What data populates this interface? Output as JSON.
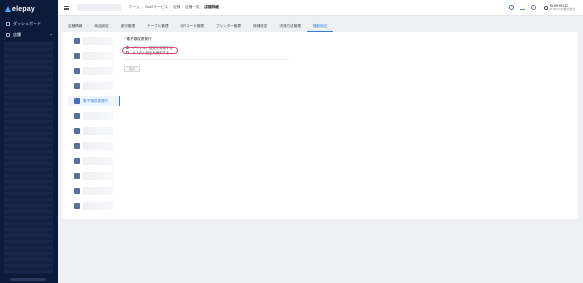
{
  "sidebar": {
    "logo_text": "elepay",
    "items": [
      {
        "label": "ダッシュボード"
      },
      {
        "label": "店舗"
      }
    ]
  },
  "header": {
    "breadcrumb": [
      "ホーム",
      "SaaSサービス",
      "店舗",
      "店舗一覧",
      "店舗詳細"
    ],
    "user_name": "SUSHIYUZ",
    "user_sub": "SUSHIYUZ株式会社"
  },
  "tabs": [
    {
      "label": "店舗情報"
    },
    {
      "label": "商品設定"
    },
    {
      "label": "席次管理"
    },
    {
      "label": "テーブル管理"
    },
    {
      "label": "QRコード管理"
    },
    {
      "label": "プリンター管理"
    },
    {
      "label": "詳細設定"
    },
    {
      "label": "決済方法管理"
    },
    {
      "label": "機能設定",
      "active": true
    }
  ],
  "menu": {
    "active_label": "電子領収書発行"
  },
  "settings": {
    "title": "電子領収書発行",
    "options": [
      {
        "label": "デフォルト設定を使用する"
      },
      {
        "label": "カスタム設定を使用する"
      }
    ],
    "save_label": "保存"
  }
}
